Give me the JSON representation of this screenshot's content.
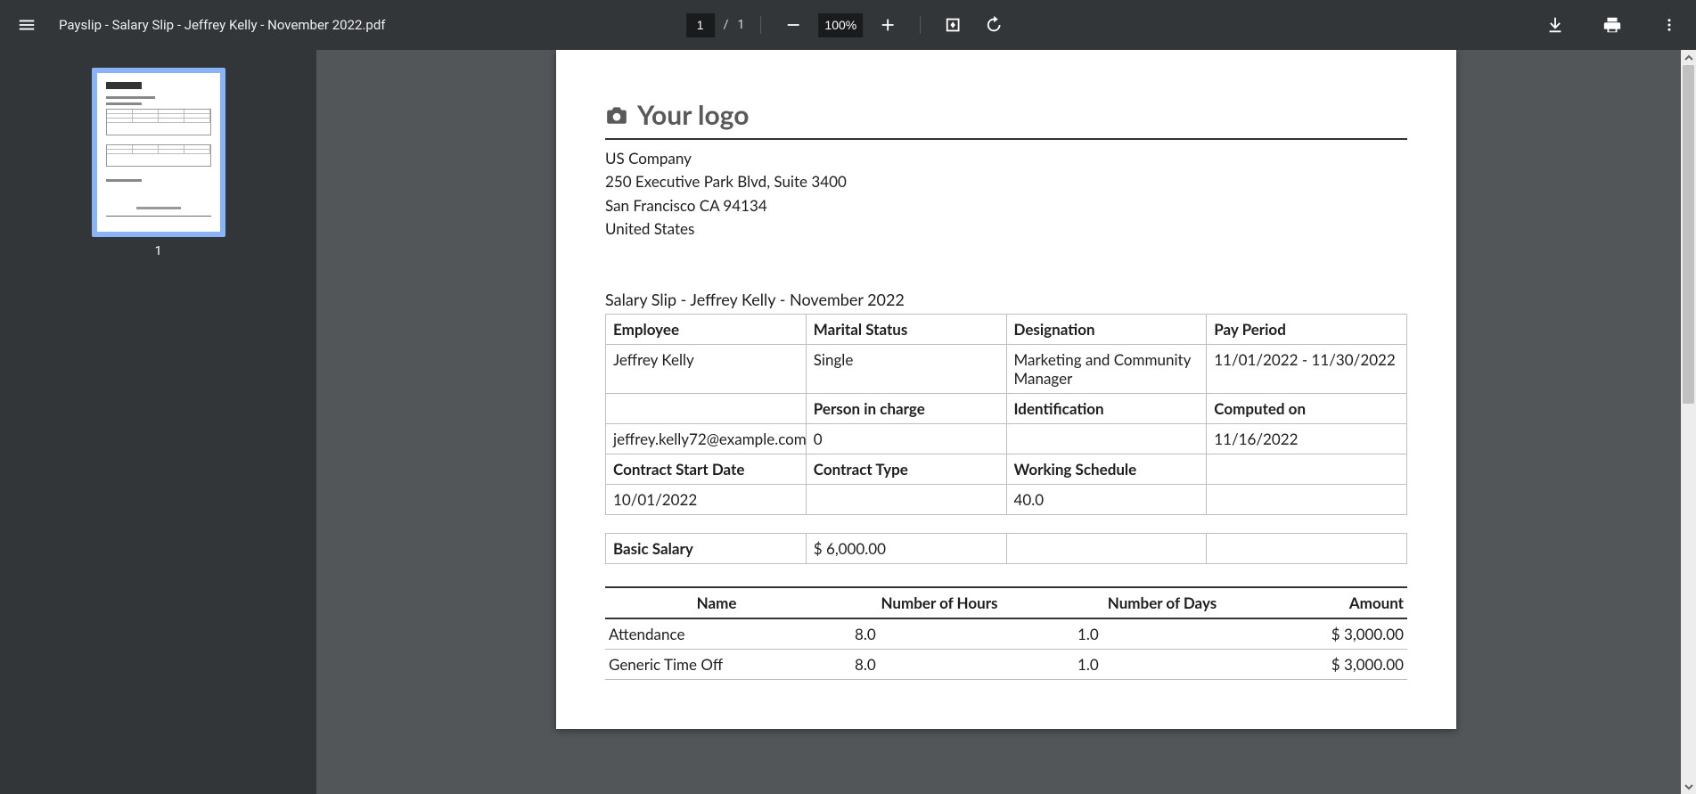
{
  "toolbar": {
    "filename": "Payslip - Salary Slip - Jeffrey Kelly - November 2022.pdf",
    "page_current": "1",
    "page_sep": "/",
    "page_total": "1",
    "zoom_value": "100%"
  },
  "sidebar": {
    "thumb_label": "1"
  },
  "doc": {
    "logo_text": "Your logo",
    "company": {
      "name": "US Company",
      "street": "250 Executive Park Blvd, Suite 3400",
      "city": "San Francisco CA 94134",
      "country": "United States"
    },
    "slip_title": "Salary Slip - Jeffrey Kelly - November 2022",
    "info": {
      "h_employee": "Employee",
      "h_marital": "Marital Status",
      "h_designation": "Designation",
      "h_payperiod": "Pay Period",
      "v_employee": "Jeffrey Kelly",
      "v_marital": "Single",
      "v_designation": "Marketing and Community Manager",
      "v_payperiod": "11/01/2022 - 11/30/2022",
      "h_person": "Person in charge",
      "h_ident": "Identification",
      "h_computed": "Computed on",
      "v_email": "jeffrey.kelly72@example.com",
      "v_person": "0",
      "v_ident": "",
      "v_computed": "11/16/2022",
      "h_contract_start": "Contract Start Date",
      "h_contract_type": "Contract Type",
      "h_schedule": "Working Schedule",
      "v_contract_start": "10/01/2022",
      "v_contract_type": "",
      "v_schedule": "40.0"
    },
    "salary": {
      "label": "Basic Salary",
      "value": "$ 6,000.00"
    },
    "lines": {
      "h_name": "Name",
      "h_hours": "Number of Hours",
      "h_days": "Number of Days",
      "h_amount": "Amount",
      "rows": [
        {
          "name": "Attendance",
          "hours": "8.0",
          "days": "1.0",
          "amount": "$ 3,000.00"
        },
        {
          "name": "Generic Time Off",
          "hours": "8.0",
          "days": "1.0",
          "amount": "$ 3,000.00"
        }
      ]
    }
  }
}
